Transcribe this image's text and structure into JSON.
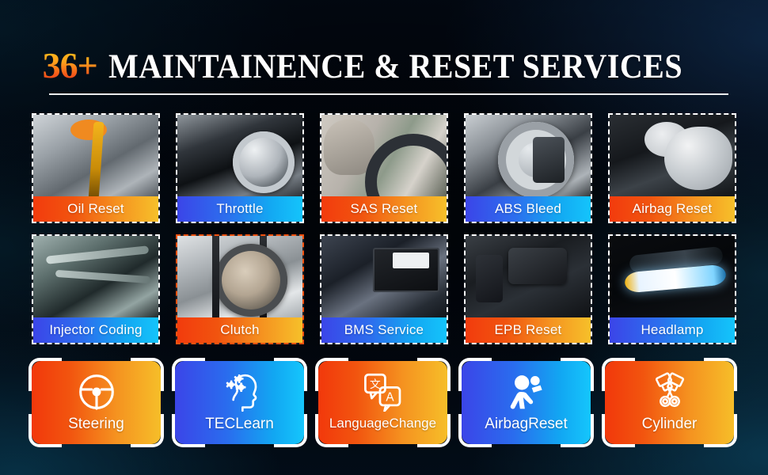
{
  "header": {
    "count": "36+",
    "title": "MAINTAINENCE & RESET SERVICES"
  },
  "colors": {
    "warm_start": "#F2380B",
    "warm_end": "#F6BE29",
    "cool_start": "#3B45E8",
    "cool_end": "#15C6FC",
    "border_white": "#FFFFFF",
    "border_orange": "#F2520F",
    "background_dark": "#020810"
  },
  "cards": [
    {
      "label": "Oil Reset",
      "theme": "warm",
      "border": "white",
      "art": "oil-pour",
      "icon": "oil-pour-photo"
    },
    {
      "label": "Throttle",
      "theme": "cool",
      "border": "white",
      "art": "throttle",
      "icon": "throttle-body-photo"
    },
    {
      "label": "SAS Reset",
      "theme": "warm",
      "border": "white",
      "art": "driver",
      "icon": "steering-driver-photo"
    },
    {
      "label": "ABS Bleed",
      "theme": "cool",
      "border": "white",
      "art": "brake",
      "icon": "brake-disc-photo"
    },
    {
      "label": "Airbag Reset",
      "theme": "warm",
      "border": "white",
      "art": "airbag",
      "icon": "airbag-deployed-photo"
    },
    {
      "label": "Injector Coding",
      "theme": "cool",
      "border": "white",
      "art": "injector",
      "icon": "engine-injector-photo"
    },
    {
      "label": "Clutch",
      "theme": "warm",
      "border": "orange",
      "art": "clutch",
      "icon": "clutch-flywheel-photo"
    },
    {
      "label": "BMS Service",
      "theme": "cool",
      "border": "white",
      "art": "battery",
      "icon": "car-battery-photo"
    },
    {
      "label": "EPB Reset",
      "theme": "warm",
      "border": "white",
      "art": "epb",
      "icon": "parking-brake-switch-photo"
    },
    {
      "label": "Headlamp",
      "theme": "cool",
      "border": "white",
      "art": "headlamp",
      "icon": "headlight-photo"
    }
  ],
  "buttons": [
    {
      "label": "Steering",
      "theme": "warm",
      "icon": "steering-wheel-icon"
    },
    {
      "label": "TECLearn",
      "theme": "cool",
      "icon": "head-gears-icon"
    },
    {
      "label": "LanguageChange",
      "theme": "warm",
      "icon": "translate-icon"
    },
    {
      "label": "AirbagReset",
      "theme": "cool",
      "icon": "airbag-person-icon"
    },
    {
      "label": "Cylinder",
      "theme": "warm",
      "icon": "crossed-pistons-icon"
    }
  ]
}
